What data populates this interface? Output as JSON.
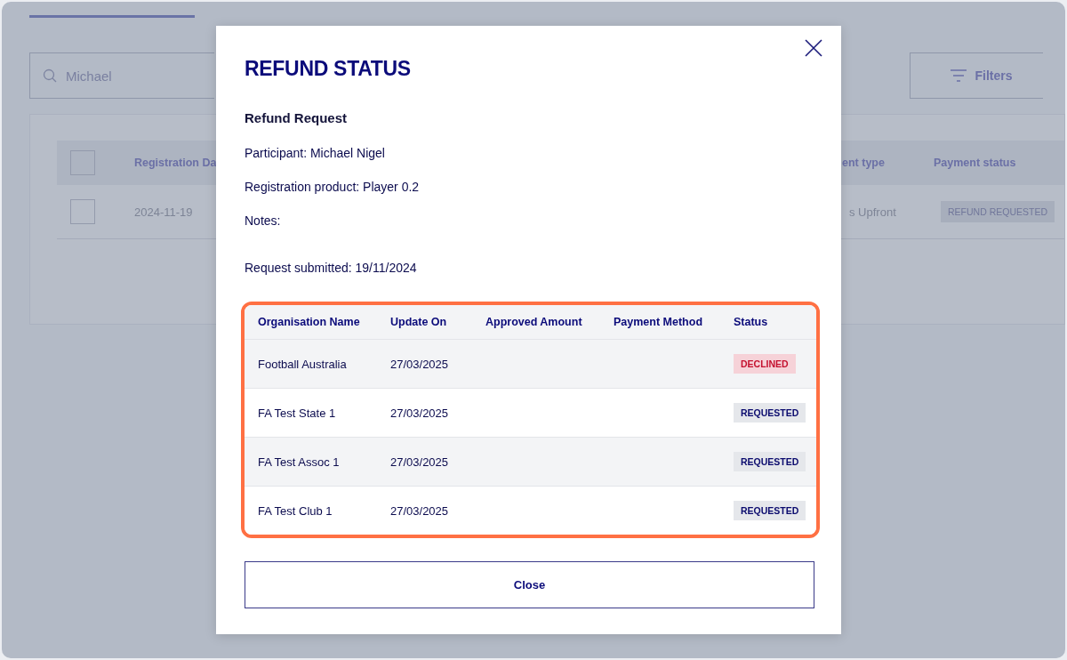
{
  "background": {
    "search": {
      "value": "Michael"
    },
    "filters_button": "Filters",
    "table": {
      "header_checked": false,
      "columns": [
        "Registration Da",
        "ent type",
        "Payment status"
      ],
      "rows": [
        {
          "checked": false,
          "cells": [
            "2024-11-19",
            "s Upfront"
          ],
          "payment_status": "REFUND REQUESTED"
        }
      ]
    }
  },
  "modal": {
    "title": "REFUND STATUS",
    "subtitle": "Refund Request",
    "details": [
      "Participant: Michael Nigel",
      "Registration product: Player 0.2",
      "Notes:",
      "Request submitted: 19/11/2024"
    ],
    "table": {
      "columns": [
        "Organisation Name",
        "Update On",
        "Approved Amount",
        "Payment Method",
        "Status"
      ],
      "rows": [
        {
          "organisation": "Football Australia",
          "updated": "27/03/2025",
          "status": {
            "text": "DECLINED",
            "kind": "declined"
          }
        },
        {
          "organisation": "FA Test State 1",
          "updated": "27/03/2025",
          "status": {
            "text": "REQUESTED",
            "kind": "requested"
          }
        },
        {
          "organisation": "FA Test Assoc 1",
          "updated": "27/03/2025",
          "status": {
            "text": "REQUESTED",
            "kind": "requested"
          }
        },
        {
          "organisation": "FA Test Club 1",
          "updated": "27/03/2025",
          "status": {
            "text": "REQUESTED",
            "kind": "requested"
          }
        }
      ]
    },
    "close_button": "Close"
  }
}
